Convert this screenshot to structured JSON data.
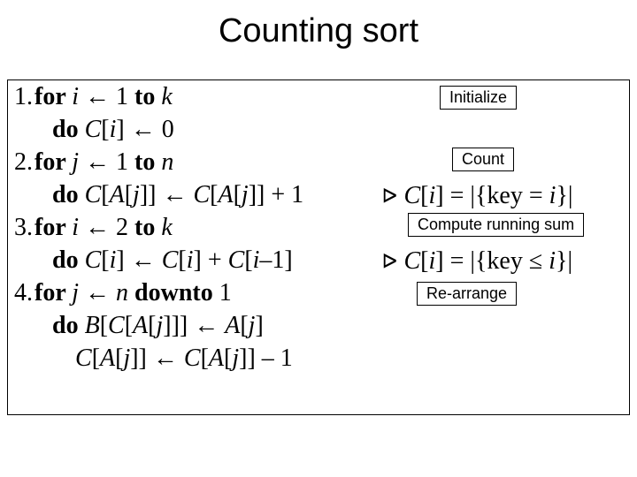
{
  "title": "Counting sort",
  "code": {
    "l1_num": "1.",
    "l1_for": "for ",
    "l1_var": "i",
    "l1_arrow": " ← 1 ",
    "l1_to": "to ",
    "l1_k": "k",
    "l2_do": "do ",
    "l2_body_a": "C",
    "l2_body_b": "[",
    "l2_body_c": "i",
    "l2_body_d": "] ← 0",
    "l3_num": "2.",
    "l3_for": "for ",
    "l3_var": "j",
    "l3_arrow": " ← 1 ",
    "l3_to": "to ",
    "l3_n": "n",
    "l4_do": "do ",
    "l4_a": "C",
    "l4_b": "[",
    "l4_c": "A",
    "l4_d": "[",
    "l4_e": "j",
    "l4_f": "]] ← ",
    "l4_g": "C",
    "l4_h": "[",
    "l4_i": "A",
    "l4_j": "[",
    "l4_k": "j",
    "l4_l": "]] + 1",
    "l5_num": "3.",
    "l5_for": "for ",
    "l5_var": "i",
    "l5_arrow": " ← 2 ",
    "l5_to": "to ",
    "l5_k": "k",
    "l6_do": "do ",
    "l6_a": "C",
    "l6_b": "[",
    "l6_c": "i",
    "l6_d": "] ← ",
    "l6_e": "C",
    "l6_f": "[",
    "l6_g": "i",
    "l6_h": "] + ",
    "l6_i": "C",
    "l6_j": "[",
    "l6_k": "i",
    "l6_l": "–1]",
    "l7_num": "4.",
    "l7_for": "for ",
    "l7_var": "j",
    "l7_arrow": " ← ",
    "l7_n": "n",
    "l7_downto": " downto ",
    "l7_one": "1",
    "l8_do": "do ",
    "l8_a": "B",
    "l8_b": "[",
    "l8_c": "C",
    "l8_d": "[",
    "l8_e": "A",
    "l8_f": "[",
    "l8_g": "j",
    "l8_h": "]]] ← ",
    "l8_i": "A",
    "l8_j": "[",
    "l8_k": "j",
    "l8_l": "]",
    "l9_a": "C",
    "l9_b": "[",
    "l9_c": "A",
    "l9_d": "[",
    "l9_e": "j",
    "l9_f": "]] ← ",
    "l9_g": "C",
    "l9_h": "[",
    "l9_i": "A",
    "l9_j": "[",
    "l9_k": "j",
    "l9_l": "]] – 1"
  },
  "annot": {
    "init": "Initialize",
    "count": "Count",
    "running": "Compute running sum",
    "rearrange": "Re-arrange",
    "note1_pre": "⊳ ",
    "note1_a": "C",
    "note1_b": "[",
    "note1_c": "i",
    "note1_d": "] = |{key = ",
    "note1_e": "i",
    "note1_f": "}|",
    "note2_pre": "⊳ ",
    "note2_a": "C",
    "note2_b": "[",
    "note2_c": "i",
    "note2_d": "] = |{key ≤ ",
    "note2_e": "i",
    "note2_f": "}|"
  }
}
